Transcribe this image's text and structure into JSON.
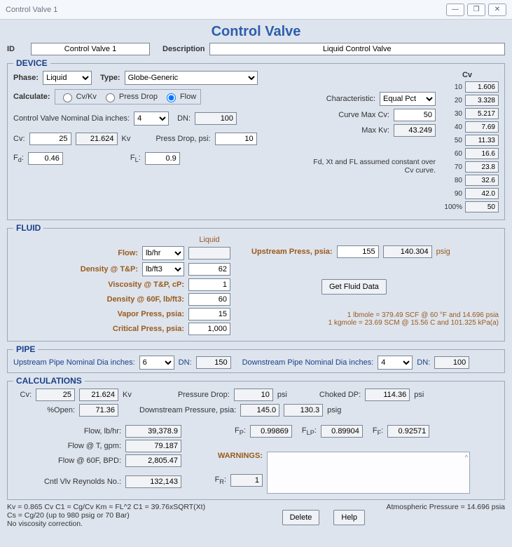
{
  "window": {
    "title": "Control Valve 1"
  },
  "header": "Control Valve",
  "id": {
    "label": "ID",
    "value": "Control Valve 1"
  },
  "desc": {
    "label": "Description",
    "value": "Liquid Control Valve"
  },
  "device": {
    "legend": "DEVICE",
    "phase": {
      "label": "Phase:",
      "value": "Liquid"
    },
    "type": {
      "label": "Type:",
      "value": "Globe-Generic"
    },
    "calc": {
      "label": "Calculate:",
      "opt1": "Cv/Kv",
      "opt2": "Press Drop",
      "opt3": "Flow"
    },
    "nomdia": {
      "label": "Control Valve Nominal Dia inches:",
      "value": "4",
      "dnlabel": "DN:",
      "dn": "100"
    },
    "cv": {
      "label": "Cv:",
      "v1": "25",
      "v2": "21.624",
      "kv": "Kv"
    },
    "pd": {
      "label": "Press Drop, psi:",
      "value": "10"
    },
    "fd": {
      "label": "Fd:",
      "sub": "d",
      "value": "0.46"
    },
    "fl": {
      "label": "FL:",
      "sub": "L",
      "value": "0.9"
    },
    "char": {
      "label": "Characteristic:",
      "value": "Equal Pct"
    },
    "cmax": {
      "label": "Curve Max Cv:",
      "value": "50"
    },
    "kmax": {
      "label": "Max Kv:",
      "value": "43.249"
    },
    "note": "Fd, Xt and FL assumed constant over Cv curve.",
    "cvtbl": {
      "hdr": "Cv",
      "rows": [
        {
          "p": "10",
          "v": "1.606"
        },
        {
          "p": "20",
          "v": "3.328"
        },
        {
          "p": "30",
          "v": "5.217"
        },
        {
          "p": "40",
          "v": "7.69"
        },
        {
          "p": "50",
          "v": "11.33"
        },
        {
          "p": "60",
          "v": "16.6"
        },
        {
          "p": "70",
          "v": "23.8"
        },
        {
          "p": "80",
          "v": "32.6"
        },
        {
          "p": "90",
          "v": "42.0"
        },
        {
          "p": "100%",
          "v": "50"
        }
      ]
    }
  },
  "fluid": {
    "legend": "FLUID",
    "colhdr": "Liquid",
    "flow": {
      "label": "Flow:",
      "unit": "lb/hr",
      "value": ""
    },
    "dtp": {
      "label": "Density @ T&P:",
      "unit": "lb/ft3",
      "value": "62"
    },
    "visc": {
      "label": "Viscosity @ T&P, cP:",
      "value": "1"
    },
    "d60": {
      "label": "Density @ 60F, lb/ft3:",
      "value": "60"
    },
    "vp": {
      "label": "Vapor Press, psia:",
      "value": "15"
    },
    "cp": {
      "label": "Critical Press, psia:",
      "value": "1,000"
    },
    "up": {
      "label": "Upstream Press, psia:",
      "v1": "155",
      "v2": "140.304",
      "unit": "psig"
    },
    "btn": "Get Fluid Data",
    "note1": "1 lbmole = 379.49 SCF @ 60 °F and 14.696 psia",
    "note2": "1 kgmole = 23.69 SCM @ 15.56 C and 101.325 kPa(a)"
  },
  "pipe": {
    "legend": "PIPE",
    "us": {
      "label": "Upstream Pipe Nominal Dia inches:",
      "value": "6",
      "dnlabel": "DN:",
      "dn": "150"
    },
    "ds": {
      "label": "Downstream Pipe Nominal Dia inches:",
      "value": "4",
      "dnlabel": "DN:",
      "dn": "100"
    }
  },
  "calc": {
    "legend": "CALCULATIONS",
    "cv": {
      "label": "Cv:",
      "v1": "25",
      "v2": "21.624",
      "kv": "Kv"
    },
    "po": {
      "label": "%Open:",
      "value": "71.36"
    },
    "pd": {
      "label": "Pressure Drop:",
      "value": "10",
      "unit": "psi"
    },
    "cd": {
      "label": "Choked DP:",
      "value": "114.36",
      "unit": "psi"
    },
    "dp": {
      "label": "Downstream Pressure, psia:",
      "v1": "145.0",
      "v2": "130.3",
      "unit": "psig"
    },
    "fl": {
      "label": "Flow, lb/hr:",
      "value": "39,378.9"
    },
    "ft": {
      "label": "Flow @ T, gpm:",
      "value": "79.187"
    },
    "f60": {
      "label": "Flow @ 60F, BPD:",
      "value": "2,805.47"
    },
    "rn": {
      "label": "Cntl Vlv Reynolds No.:",
      "value": "132,143"
    },
    "fp": {
      "label": "FP:",
      "sub": "P",
      "value": "0.99869"
    },
    "flp": {
      "label": "FLP:",
      "sub": "LP",
      "value": "0.89904"
    },
    "ff": {
      "label": "FF:",
      "sub": "F",
      "value": "0.92571"
    },
    "fr": {
      "label": "FR:",
      "sub": "R",
      "value": "1"
    },
    "warn": "WARNINGS:"
  },
  "foot": {
    "l1": "Kv = 0.865 Cv   C1 = Cg/Cv   Km = FL^2   C1 = 39.76xSQRT(Xt)",
    "l2": "Cs = Cg/20 (up to 980 psig or 70 Bar)",
    "l3": "No viscosity correction.",
    "atm": "Atmospheric Pressure = 14.696 psia",
    "del": "Delete",
    "help": "Help"
  }
}
